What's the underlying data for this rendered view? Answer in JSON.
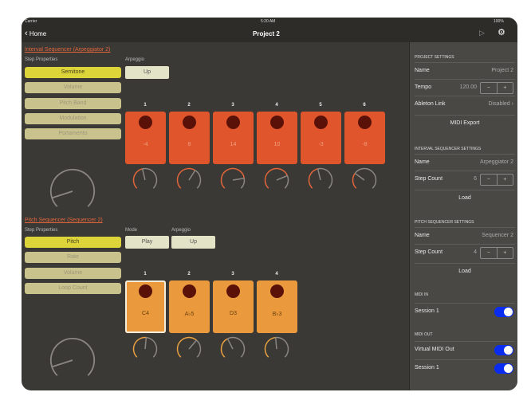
{
  "status": {
    "carrier": "Carrier",
    "time": "5:20 AM",
    "battery": "100%"
  },
  "nav": {
    "back": "Home",
    "title": "Project 2",
    "play_icon": "play-icon",
    "settings_icon": "gear-icon"
  },
  "interval": {
    "title": "Interval Sequencer (Arpeggiator 2)",
    "step_props_label": "Step Properties",
    "arp_label": "Arpeggio",
    "arp_value": "Up",
    "props": [
      "Semitone",
      "Volume",
      "Pitch Band",
      "Modulation",
      "Portamento"
    ],
    "steps": [
      {
        "n": "1",
        "v": "-4",
        "knob": 0.45
      },
      {
        "n": "2",
        "v": "8",
        "knob": 0.62
      },
      {
        "n": "3",
        "v": "14",
        "knob": 0.8
      },
      {
        "n": "4",
        "v": "10",
        "knob": 0.75
      },
      {
        "n": "5",
        "v": "-3",
        "knob": 0.45
      },
      {
        "n": "6",
        "v": "-8",
        "knob": 0.3
      }
    ],
    "master_knob": 0.1
  },
  "pitch": {
    "title": "Pitch Sequencer (Sequencer 2)",
    "step_props_label": "Step Properties",
    "mode_label": "Mode",
    "mode_value": "Play",
    "arp_label": "Arpeggio",
    "arp_value": "Up",
    "props": [
      "Pitch",
      "Rate",
      "Volume",
      "Loop Count"
    ],
    "steps": [
      {
        "n": "1",
        "v": "C4",
        "knob": 0.52
      },
      {
        "n": "2",
        "v": "A♭5",
        "knob": 0.65
      },
      {
        "n": "3",
        "v": "D3",
        "knob": 0.4
      },
      {
        "n": "4",
        "v": "B♭3",
        "knob": 0.48
      }
    ],
    "master_knob": 0.1
  },
  "side": {
    "project": {
      "header": "PROJECT SETTINGS",
      "name_label": "Name",
      "name": "Project 2",
      "tempo_label": "Tempo",
      "tempo": "120.00",
      "link_label": "Ableton Link",
      "link": "Disabled",
      "export": "MIDI Export"
    },
    "interval": {
      "header": "INTERVAL SEQUENCER SETTINGS",
      "name_label": "Name",
      "name": "Arpeggiator 2",
      "count_label": "Step Count",
      "count": "6",
      "load": "Load"
    },
    "pitch": {
      "header": "PITCH SEQUENCER SETTINGS",
      "name_label": "Name",
      "name": "Sequencer 2",
      "count_label": "Step Count",
      "count": "4",
      "load": "Load"
    },
    "midi_in": {
      "header": "MIDI IN",
      "items": [
        {
          "label": "Session 1",
          "on": true
        }
      ]
    },
    "midi_out": {
      "header": "MIDI OUT",
      "items": [
        {
          "label": "Virtual MIDI Out",
          "on": true
        },
        {
          "label": "Session 1",
          "on": true
        }
      ]
    },
    "minus": "−",
    "plus": "+",
    "chev": "›"
  },
  "colors": {
    "interval_card": "#e0552c",
    "pitch_card": "#ea9a3c",
    "toggle": "#0a2bf0"
  }
}
